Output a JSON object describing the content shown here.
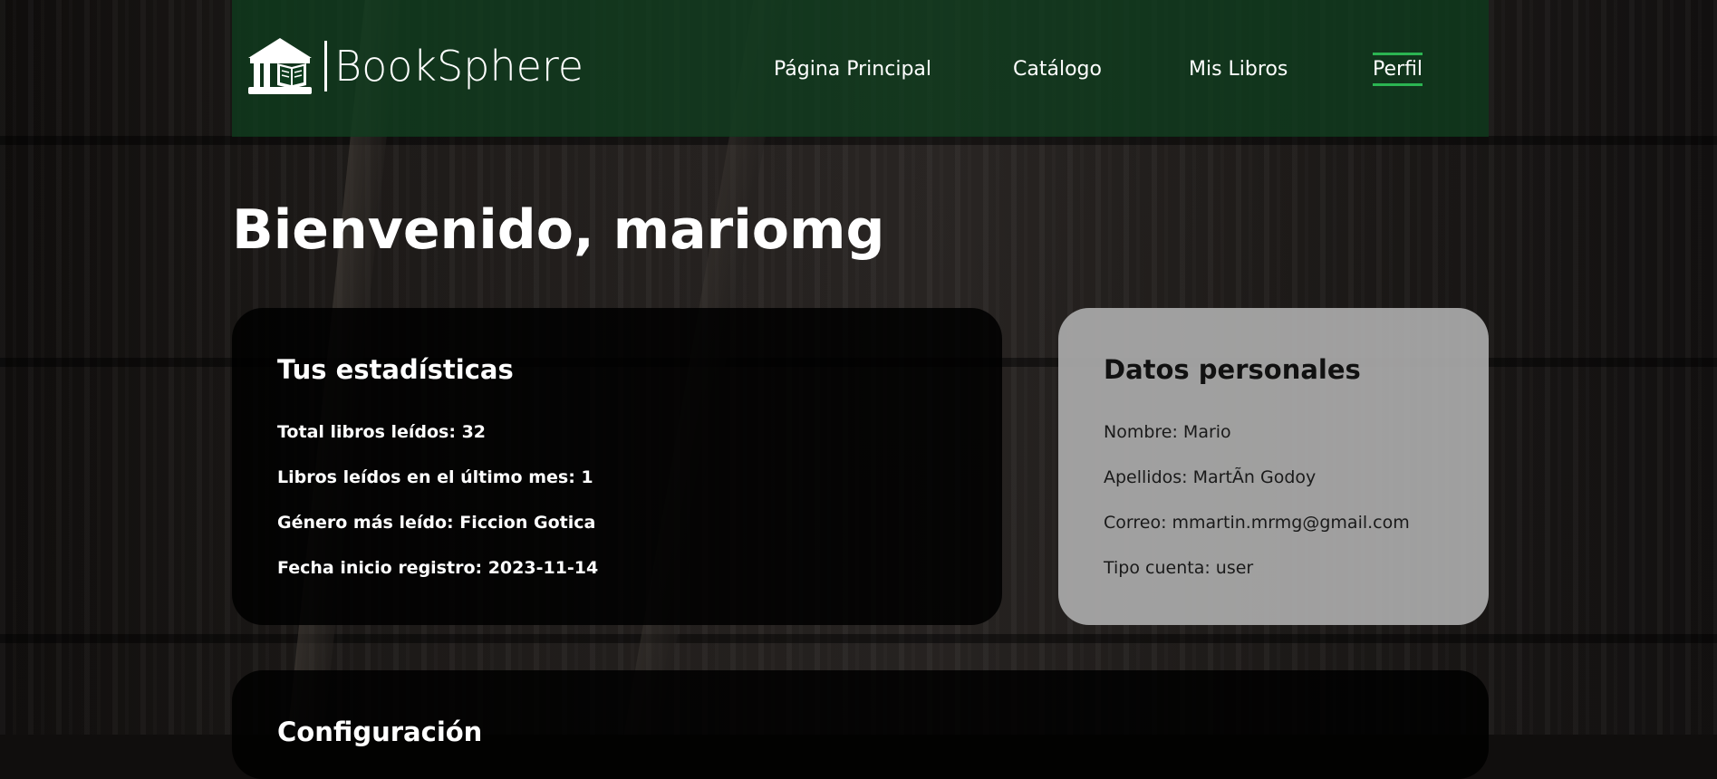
{
  "brand": {
    "name": "BookSphere",
    "icon": "library-book-icon"
  },
  "nav": {
    "items": [
      {
        "label": "Página Principal",
        "active": false
      },
      {
        "label": "Catálogo",
        "active": false
      },
      {
        "label": "Mis Libros",
        "active": false
      },
      {
        "label": "Perfil",
        "active": true
      }
    ],
    "active_color": "#2bb552"
  },
  "welcome": {
    "title": "Bienvenido, mariomg"
  },
  "stats": {
    "title": "Tus estadísticas",
    "lines": [
      "Total libros leídos: 32",
      "Libros leídos en el último mes: 1",
      "Género más leído: Ficcion Gotica",
      "Fecha inicio registro: 2023-11-14"
    ]
  },
  "personal": {
    "title": "Datos personales",
    "lines": [
      "Nombre: Mario",
      "Apellidos: MartÃn Godoy",
      "Correo: mmartin.mrmg@gmail.com",
      "Tipo cuenta: user"
    ]
  },
  "config": {
    "title": "Configuración"
  },
  "colors": {
    "header_bg": "#0e3c1e",
    "accent": "#2bb552"
  }
}
